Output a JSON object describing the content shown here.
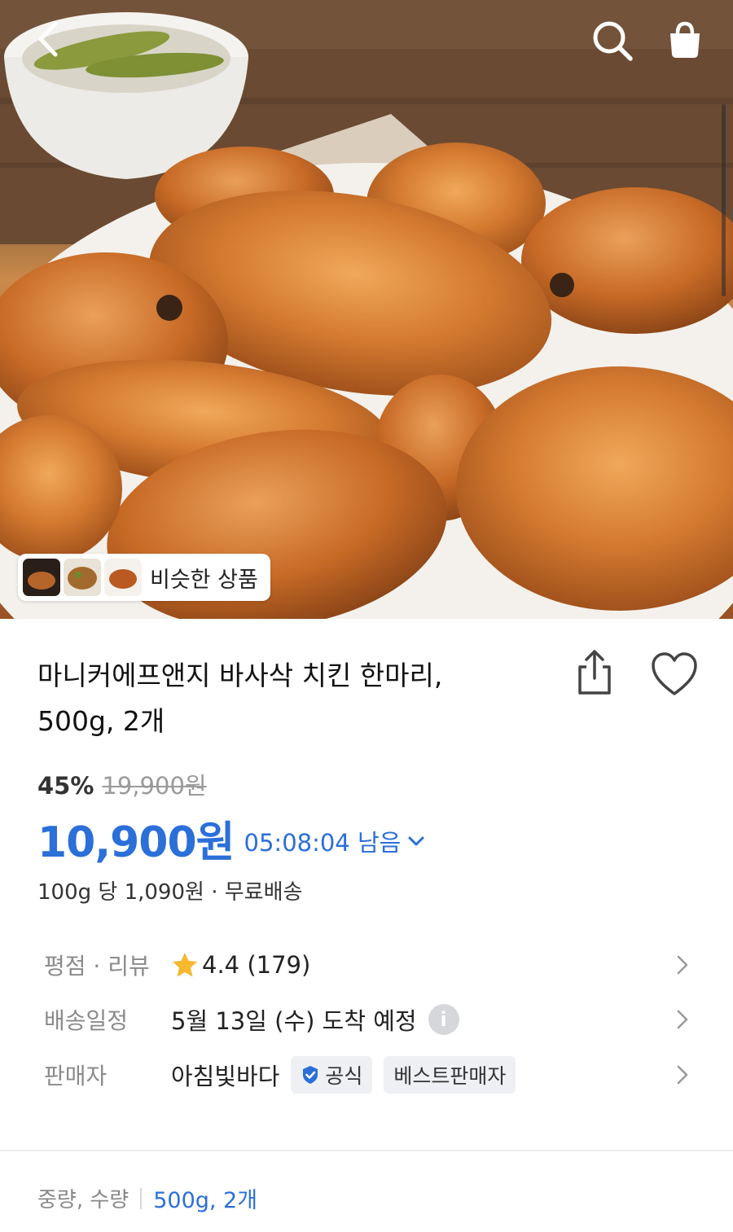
{
  "header": {
    "back_icon": "chevron-left-icon",
    "search_icon": "search-icon",
    "cart_icon": "shopping-bag-icon"
  },
  "gallery": {
    "similar_label": "비슷한 상품"
  },
  "product": {
    "title": "마니커에프앤지 바사삭 치킨 한마리, 500g, 2개",
    "discount": "45%",
    "original_price": "19,900원",
    "price": "10,900원",
    "timer": "05:08:04 남음",
    "unit_info": "100g 당 1,090원 · 무료배송"
  },
  "details": {
    "rating_label": "평점 · 리뷰",
    "rating_value": "4.4 (179)",
    "delivery_label": "배송일정",
    "delivery_value": "5월 13일 (수) 도착 예정",
    "seller_label": "판매자",
    "seller_name": "아침빛바다",
    "official_badge": "공식",
    "best_badge": "베스트판매자"
  },
  "option": {
    "label": "중량, 수량",
    "value": "500g, 2개"
  },
  "colors": {
    "accent": "#2b6fd9",
    "star": "#f5b82e",
    "muted": "#8a8a8a"
  }
}
